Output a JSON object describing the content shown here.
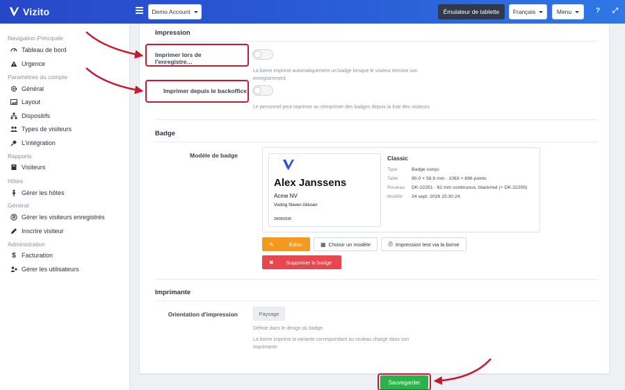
{
  "app": {
    "name": "Vizito"
  },
  "topbar": {
    "account_label": "Demo Account",
    "tablet_emulator_label": "Émulateur de tablette",
    "language_label": "Français",
    "menu_label": "Menu",
    "help_glyph": "?",
    "expand_glyph": "⤢"
  },
  "sidebar": {
    "sections": [
      {
        "title": "Navigation Principale",
        "items": [
          {
            "label": "Tableau de bord",
            "icon": "dashboard-icon"
          },
          {
            "label": "Urgence",
            "icon": "warning-icon"
          }
        ]
      },
      {
        "title": "Paramètres du compte",
        "items": [
          {
            "label": "Général",
            "icon": "gear-icon"
          },
          {
            "label": "Layout",
            "icon": "image-icon"
          },
          {
            "label": "Dispositifs",
            "icon": "sitemap-icon"
          },
          {
            "label": "Types de visiteurs",
            "icon": "users-icon"
          },
          {
            "label": "L'intégration",
            "icon": "plug-icon"
          }
        ]
      },
      {
        "title": "Rapports",
        "items": [
          {
            "label": "Visiteurs",
            "icon": "book-icon"
          }
        ]
      },
      {
        "title": "Hôtes",
        "items": [
          {
            "label": "Gérer les hôtes",
            "icon": "person-icon"
          }
        ]
      },
      {
        "title": "Général",
        "items": [
          {
            "label": "Gérer les visiteurs enregistrés",
            "icon": "registered-icon"
          },
          {
            "label": "Inscrire visiteur",
            "icon": "pencil-icon"
          }
        ]
      },
      {
        "title": "Administration",
        "items": [
          {
            "label": "Facturation",
            "icon": "dollar-icon"
          },
          {
            "label": "Gérer les utilisateurs",
            "icon": "user-plus-icon"
          }
        ]
      }
    ]
  },
  "impression": {
    "title": "Impression",
    "print_on_register_label": "Imprimer lors de l'enregistre…",
    "print_on_register_help": "La borne imprime automatiquement un badge lorsque le visiteur termine son enregistrement.",
    "print_on_register_enabled": false,
    "print_from_backoffice_label": "Imprimer depuis le backoffice",
    "print_from_backoffice_help": "Le personnel peut imprimer ou réimprimer des badges depuis la liste des visiteurs.",
    "print_from_backoffice_enabled": false
  },
  "badge": {
    "title": "Badge",
    "model_label": "Modèle de badge",
    "preview": {
      "name": "Alex Janssens",
      "company": "Acme NV",
      "visiting": "Visiting Steven Gilissen",
      "date": "24/09/2026"
    },
    "meta_title": "Classic",
    "meta": [
      {
        "key": "Type",
        "value": "Badge conçu"
      },
      {
        "key": "Taille",
        "value": "90.0 × 58.9 mm · 1063 × 696 points"
      },
      {
        "key": "Rouleau",
        "value": "DK-22251 · 62 mm continuous, black/red (+ DK-22205)"
      },
      {
        "key": "Modifié",
        "value": "24 sept. 2026 15:30:24"
      }
    ],
    "edit_label": "Éditer",
    "choose_model_label": "Choisir un modèle",
    "test_print_label": "Impression test via la borne",
    "delete_label": "Supprimer le badge"
  },
  "printer": {
    "title": "Imprimante",
    "orientation_label": "Orientation d'impression",
    "orientation_value": "Paysage",
    "orientation_help_1": "Définie dans le design du badge.",
    "orientation_help_2": "La borne imprime la variante correspondant au rouleau chargé dans son imprimante."
  },
  "footer": {
    "save_label": "Sauvegarder"
  },
  "colors": {
    "accent": "#2a5fd8",
    "highlight": "#c8172e",
    "save": "#2bb34a",
    "edit": "#f39a1e",
    "delete": "#e8474d"
  }
}
